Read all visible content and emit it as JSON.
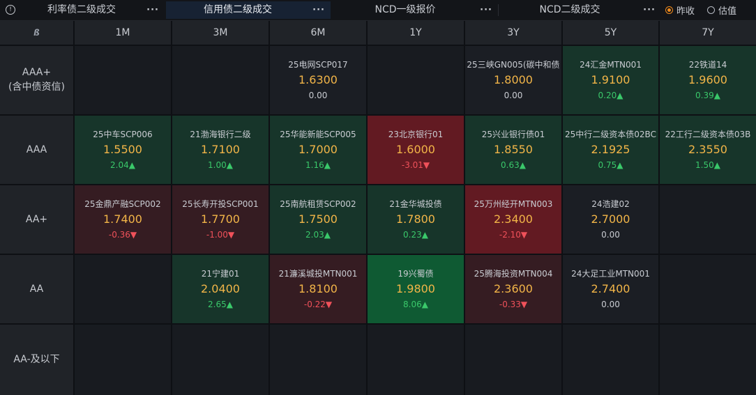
{
  "tabs": [
    {
      "label": "利率债二级成交",
      "active": false
    },
    {
      "label": "信用债二级成交",
      "active": true
    },
    {
      "label": "NCD一级报价",
      "active": false
    },
    {
      "label": "NCD二级成交",
      "active": false
    }
  ],
  "more_label": "···",
  "info_glyph": "!",
  "radio": [
    {
      "label": "昨收",
      "checked": true
    },
    {
      "label": "估值",
      "checked": false
    }
  ],
  "corner_icon": "ß",
  "tenors": [
    "1M",
    "3M",
    "6M",
    "1Y",
    "3Y",
    "5Y",
    "7Y"
  ],
  "ratings": [
    {
      "label": "AAA+",
      "sub": "(含中债资信)"
    },
    {
      "label": "AAA",
      "sub": ""
    },
    {
      "label": "AA+",
      "sub": ""
    },
    {
      "label": "AA",
      "sub": ""
    },
    {
      "label": "AA-及以下",
      "sub": ""
    }
  ],
  "colors": {
    "up": "#3ac86a",
    "down": "#f0515a",
    "yield": "#f2b548",
    "active_tab": "#172233",
    "radio_on": "#f08a1c"
  },
  "cells": [
    [
      null,
      null,
      {
        "bond": "25电网SCP017",
        "yield": "1.6300",
        "change": "0.00",
        "dir": "flat",
        "shade": "neutral"
      },
      null,
      {
        "bond": "25三峡GN005(碳中和债",
        "yield": "1.8000",
        "change": "0.00",
        "dir": "flat",
        "shade": "neutral"
      },
      {
        "bond": "24汇金MTN001",
        "yield": "1.9100",
        "change": "0.20",
        "dir": "up",
        "shade": "green"
      },
      {
        "bond": "22铁道14",
        "yield": "1.9600",
        "change": "0.39",
        "dir": "up",
        "shade": "green"
      }
    ],
    [
      {
        "bond": "25中车SCP006",
        "yield": "1.5500",
        "change": "2.04",
        "dir": "up",
        "shade": "green"
      },
      {
        "bond": "21渤海银行二级",
        "yield": "1.7100",
        "change": "1.00",
        "dir": "up",
        "shade": "green"
      },
      {
        "bond": "25华能新能SCP005",
        "yield": "1.7000",
        "change": "1.16",
        "dir": "up",
        "shade": "green"
      },
      {
        "bond": "23北京银行01",
        "yield": "1.6000",
        "change": "-3.01",
        "dir": "down",
        "shade": "red-strong"
      },
      {
        "bond": "25兴业银行债01",
        "yield": "1.8550",
        "change": "0.63",
        "dir": "up",
        "shade": "green"
      },
      {
        "bond": "25中行二级资本债02BC",
        "yield": "2.1925",
        "change": "0.75",
        "dir": "up",
        "shade": "green"
      },
      {
        "bond": "22工行二级资本债03B",
        "yield": "2.3550",
        "change": "1.50",
        "dir": "up",
        "shade": "green"
      }
    ],
    [
      {
        "bond": "25金鼎产融SCP002",
        "yield": "1.7400",
        "change": "-0.36",
        "dir": "down",
        "shade": "red"
      },
      {
        "bond": "25长寿开投SCP001",
        "yield": "1.7700",
        "change": "-1.00",
        "dir": "down",
        "shade": "red"
      },
      {
        "bond": "25南航租赁SCP002",
        "yield": "1.7500",
        "change": "2.03",
        "dir": "up",
        "shade": "green"
      },
      {
        "bond": "21金华城投债",
        "yield": "1.7800",
        "change": "0.23",
        "dir": "up",
        "shade": "green"
      },
      {
        "bond": "25万州经开MTN003",
        "yield": "2.3400",
        "change": "-2.10",
        "dir": "down",
        "shade": "red-strong"
      },
      {
        "bond": "24浩建02",
        "yield": "2.7000",
        "change": "0.00",
        "dir": "flat",
        "shade": "neutral"
      },
      null
    ],
    [
      null,
      {
        "bond": "21宁建01",
        "yield": "2.0400",
        "change": "2.65",
        "dir": "up",
        "shade": "green"
      },
      {
        "bond": "21濂溪城投MTN001",
        "yield": "1.8100",
        "change": "-0.22",
        "dir": "down",
        "shade": "red"
      },
      {
        "bond": "19兴蜀债",
        "yield": "1.9800",
        "change": "8.06",
        "dir": "up",
        "shade": "green-strong"
      },
      {
        "bond": "25腾海投资MTN004",
        "yield": "2.3600",
        "change": "-0.33",
        "dir": "down",
        "shade": "red"
      },
      {
        "bond": "24大足工业MTN001",
        "yield": "2.7400",
        "change": "0.00",
        "dir": "flat",
        "shade": "neutral"
      },
      null
    ],
    [
      null,
      null,
      null,
      null,
      null,
      null,
      null
    ]
  ]
}
